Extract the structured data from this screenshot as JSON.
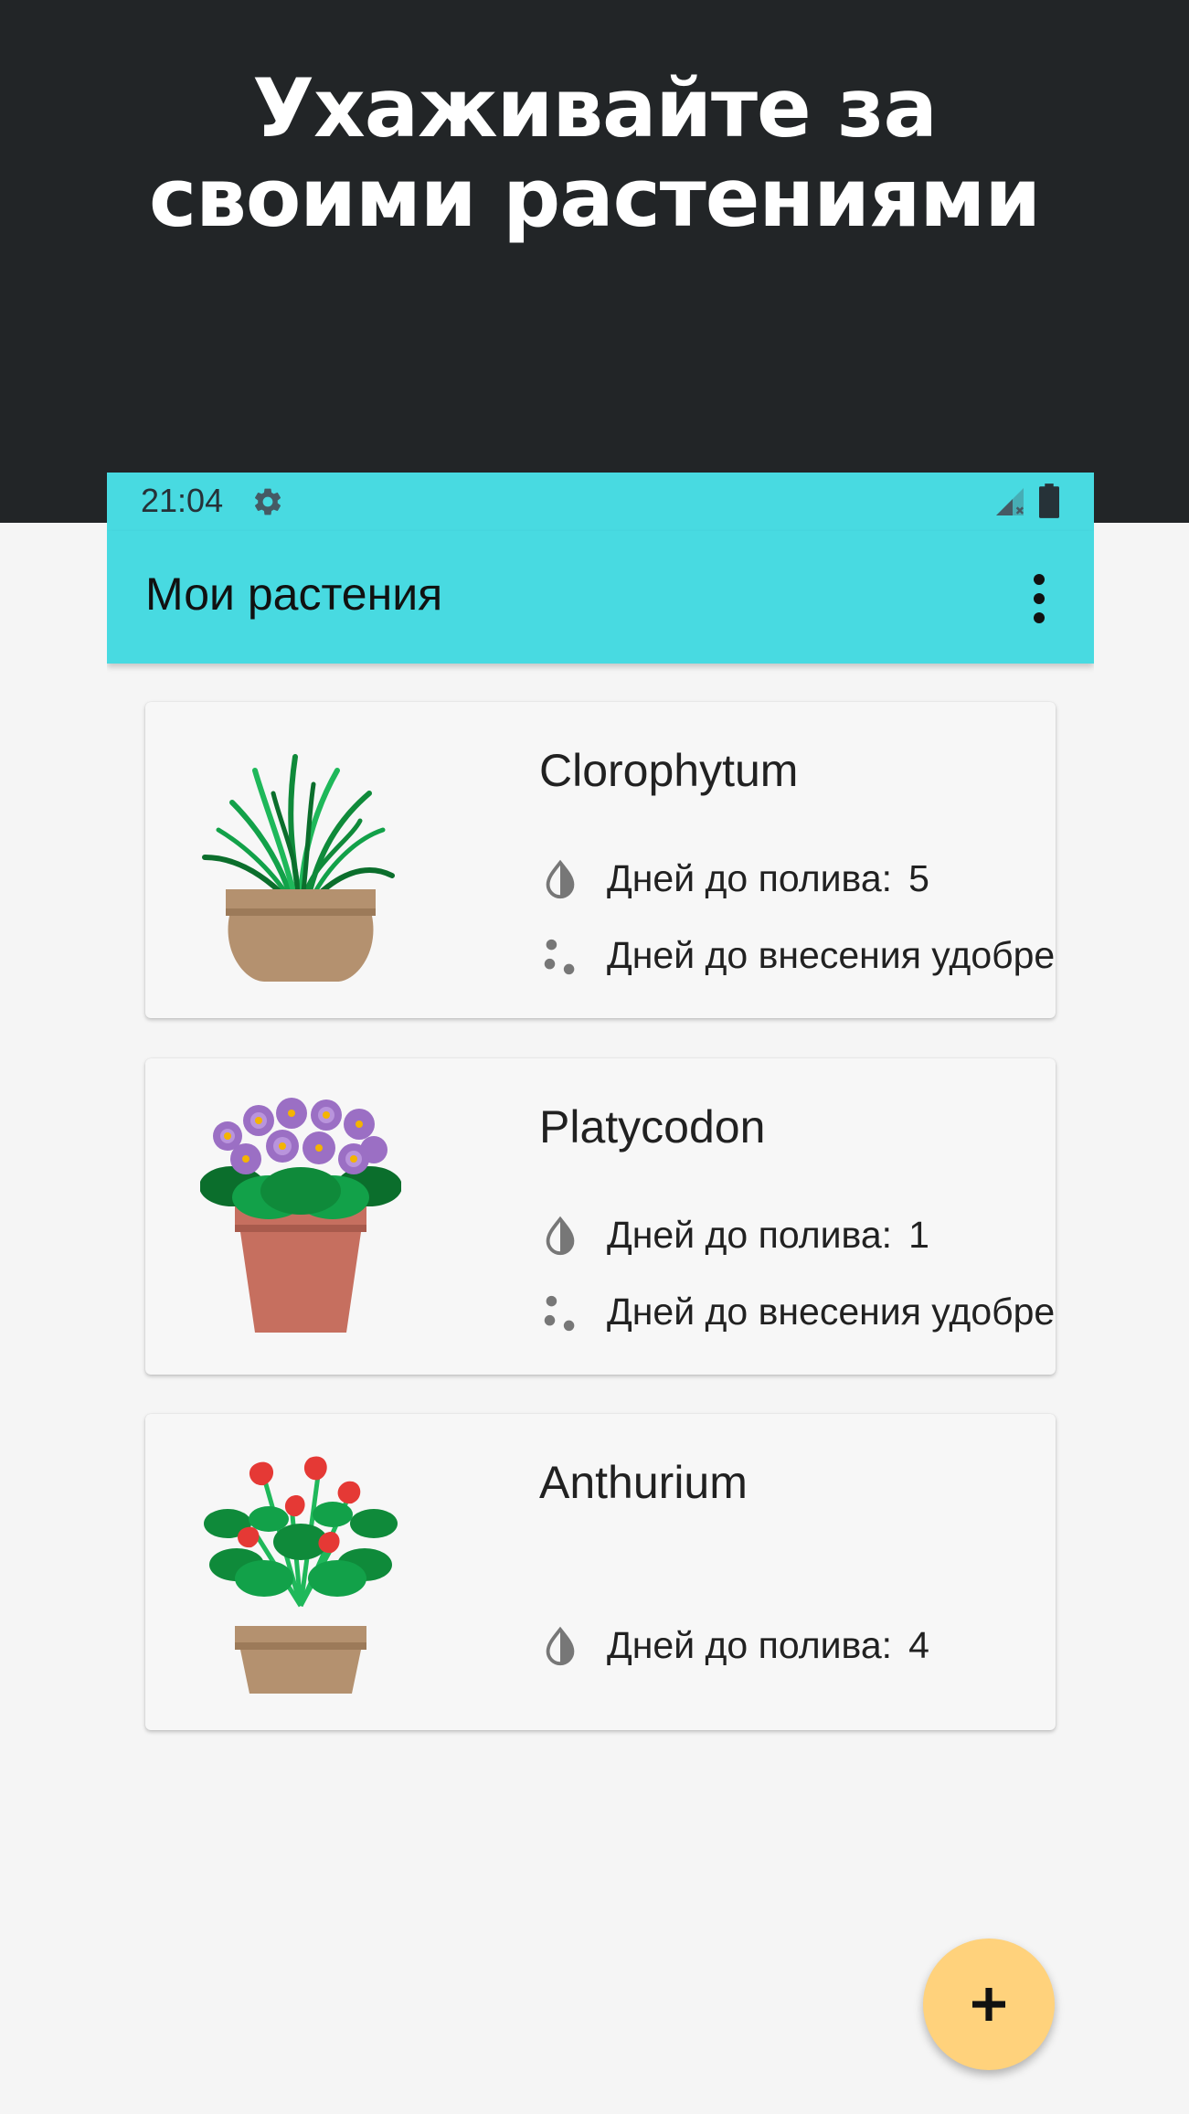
{
  "promo": {
    "headline_line1": "Ухаживайте за",
    "headline_line2": "своими растениями"
  },
  "status_bar": {
    "time": "21:04",
    "icons": [
      "gear-icon",
      "signal-icon",
      "battery-icon"
    ]
  },
  "app_bar": {
    "title": "Мои растения",
    "menu_icon": "more-vert-icon"
  },
  "plants": [
    {
      "name": "Clorophytum",
      "image": "spider-plant-in-pot",
      "watering_label": "Дней до полива:",
      "watering_value": "5",
      "fertilize_label": "Дней до внесения удобрений"
    },
    {
      "name": "Platycodon",
      "image": "violet-flowers-in-pot",
      "watering_label": "Дней до полива:",
      "watering_value": "1",
      "fertilize_label": "Дней до внесения удобрений"
    },
    {
      "name": "Anthurium",
      "image": "anthurium-in-pot",
      "watering_label": "Дней до полива:",
      "watering_value": "4"
    }
  ],
  "fab": {
    "icon": "plus-icon"
  },
  "colors": {
    "promo_background": "#222527",
    "app_bar": "#48dae1",
    "fab": "#ffd27c",
    "card": "#f7f7f7",
    "page": "#f5f5f5"
  }
}
